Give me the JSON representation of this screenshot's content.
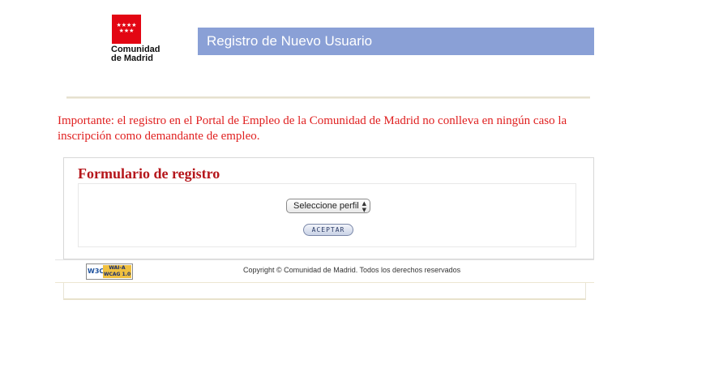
{
  "header": {
    "logo": {
      "icon": "madrid-flag-stars-icon",
      "line1": "Comunidad",
      "line2": "de Madrid",
      "color": "#e30613"
    },
    "title": "Registro de Nuevo Usuario",
    "title_bg_color": "#8aa0d6"
  },
  "notice": {
    "text": "Importante: el registro en el Portal de Empleo de la Comunidad de Madrid no conlleva en ningún caso la inscripción como demandante de empleo.",
    "color": "#e02020"
  },
  "form": {
    "title": "Formulario de registro",
    "title_color": "#b5161b",
    "profile_select": {
      "selected": "Seleccione perfil"
    },
    "accept_button": "ACEPTAR"
  },
  "footer": {
    "badge": {
      "w3c": "W3C",
      "wai": "WAI-A",
      "wcag": "WCAG 1.0"
    },
    "copyright": "Copyright © Comunidad de Madrid. Todos los derechos reservados"
  }
}
